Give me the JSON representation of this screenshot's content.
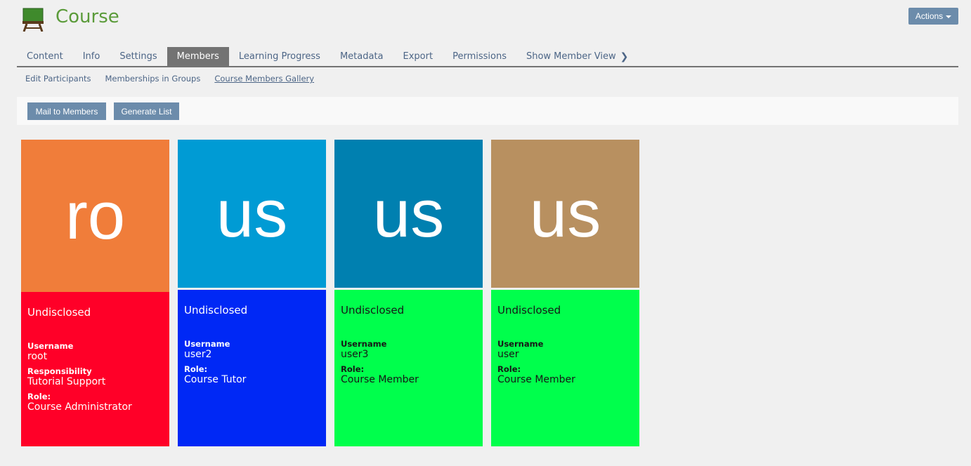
{
  "header": {
    "title": "Course",
    "icon": "course-board-icon",
    "actions_label": "Actions"
  },
  "tabs": [
    {
      "label": "Content"
    },
    {
      "label": "Info"
    },
    {
      "label": "Settings"
    },
    {
      "label": "Members",
      "active": true
    },
    {
      "label": "Learning Progress"
    },
    {
      "label": "Metadata"
    },
    {
      "label": "Export"
    },
    {
      "label": "Permissions"
    },
    {
      "label": "Show Member View",
      "icon": "chevron-right-icon"
    }
  ],
  "subtabs": [
    {
      "label": "Edit Participants"
    },
    {
      "label": "Memberships in Groups"
    },
    {
      "label": "Course Members Gallery",
      "active": true
    }
  ],
  "toolbar": {
    "mail_label": "Mail to Members",
    "generate_label": "Generate List"
  },
  "members": [
    {
      "initials": "ro",
      "name": "Undisclosed",
      "username_label": "Username",
      "username": "root",
      "responsibility_label": "Responsibility",
      "responsibility": "Tutorial Support",
      "role_label": "Role:",
      "role": "Course Administrator",
      "avatar_color": "#f07d3a",
      "card_color": "#ff0028",
      "text_color": "#ffffff"
    },
    {
      "initials": "us",
      "name": "Undisclosed",
      "username_label": "Username",
      "username": "user2",
      "role_label": "Role:",
      "role": "Course Tutor",
      "avatar_color": "#009bd4",
      "card_color": "#0028f5",
      "text_color": "#ffffff"
    },
    {
      "initials": "us",
      "name": "Undisclosed",
      "username_label": "Username",
      "username": "user3",
      "role_label": "Role:",
      "role": "Course Member",
      "avatar_color": "#0080b0",
      "card_color": "#00ff4c",
      "text_color": "#161616"
    },
    {
      "initials": "us",
      "name": "Undisclosed",
      "username_label": "Username",
      "username": "user",
      "role_label": "Role:",
      "role": "Course Member",
      "avatar_color": "#b89060",
      "card_color": "#00ff4c",
      "text_color": "#161616"
    }
  ]
}
